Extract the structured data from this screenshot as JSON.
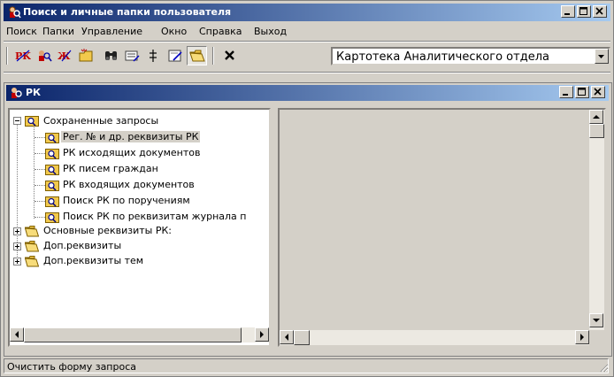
{
  "window": {
    "title": "Поиск и личные папки пользователя",
    "icon": "search-people-icon"
  },
  "menu": [
    "Поиск",
    "Папки",
    "Управление",
    "Окно",
    "Справка",
    "Выход"
  ],
  "toolbar": {
    "buttons": [
      {
        "icon": "rk-card-icon"
      },
      {
        "icon": "search-person-icon"
      },
      {
        "icon": "journal-icon"
      },
      {
        "icon": "new-folder-icon"
      },
      {
        "icon": "binoculars-icon"
      },
      {
        "icon": "form-clear-icon"
      },
      {
        "icon": "add-criteria-icon"
      },
      {
        "icon": "edit-form-icon"
      },
      {
        "icon": "open-folder-icon",
        "pressed": true
      },
      {
        "icon": "close-icon"
      }
    ],
    "combo_value": "Картотека Аналитического отдела"
  },
  "child_window": {
    "title": "РК",
    "icon": "rk-window-icon"
  },
  "tree": {
    "root_saved": "Сохраненные запросы",
    "saved_items": [
      "Рег. № и др. реквизиты РК",
      "РК исходящих документов",
      "РК писем граждан",
      "РК входящих документов",
      "Поиск РК по поручениям",
      "Поиск РК по реквизитам журнала п"
    ],
    "folders": [
      "Основные реквизиты РК:",
      "Доп.реквизиты",
      "Доп.реквизиты тем"
    ]
  },
  "status": "Очистить форму запроса",
  "colors": {
    "titlebar_start": "#0a246a",
    "titlebar_end": "#a6caf0",
    "face": "#d4d0c8",
    "folder": "#f2c94c"
  }
}
